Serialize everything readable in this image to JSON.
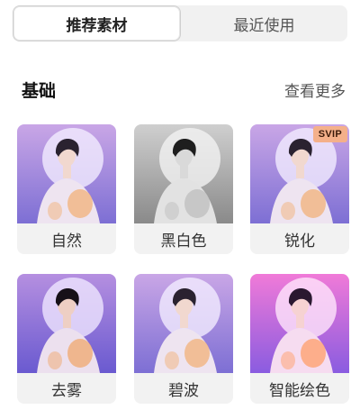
{
  "tabs": [
    {
      "label": "推荐素材",
      "active": true
    },
    {
      "label": "最近使用",
      "active": false
    }
  ],
  "section": {
    "title": "基础",
    "more_label": "查看更多"
  },
  "filters": [
    {
      "label": "自然",
      "badge": "",
      "style": "natural"
    },
    {
      "label": "黑白色",
      "badge": "",
      "style": "mono"
    },
    {
      "label": "锐化",
      "badge": "SVIP",
      "style": "natural"
    },
    {
      "label": "去雾",
      "badge": "",
      "style": "clear"
    },
    {
      "label": "碧波",
      "badge": "",
      "style": "natural"
    },
    {
      "label": "智能绘色",
      "badge": "",
      "style": "vivid"
    }
  ],
  "colors": {
    "badge_bg": "#f4b08a",
    "tab_bg": "#f1f1f1"
  }
}
